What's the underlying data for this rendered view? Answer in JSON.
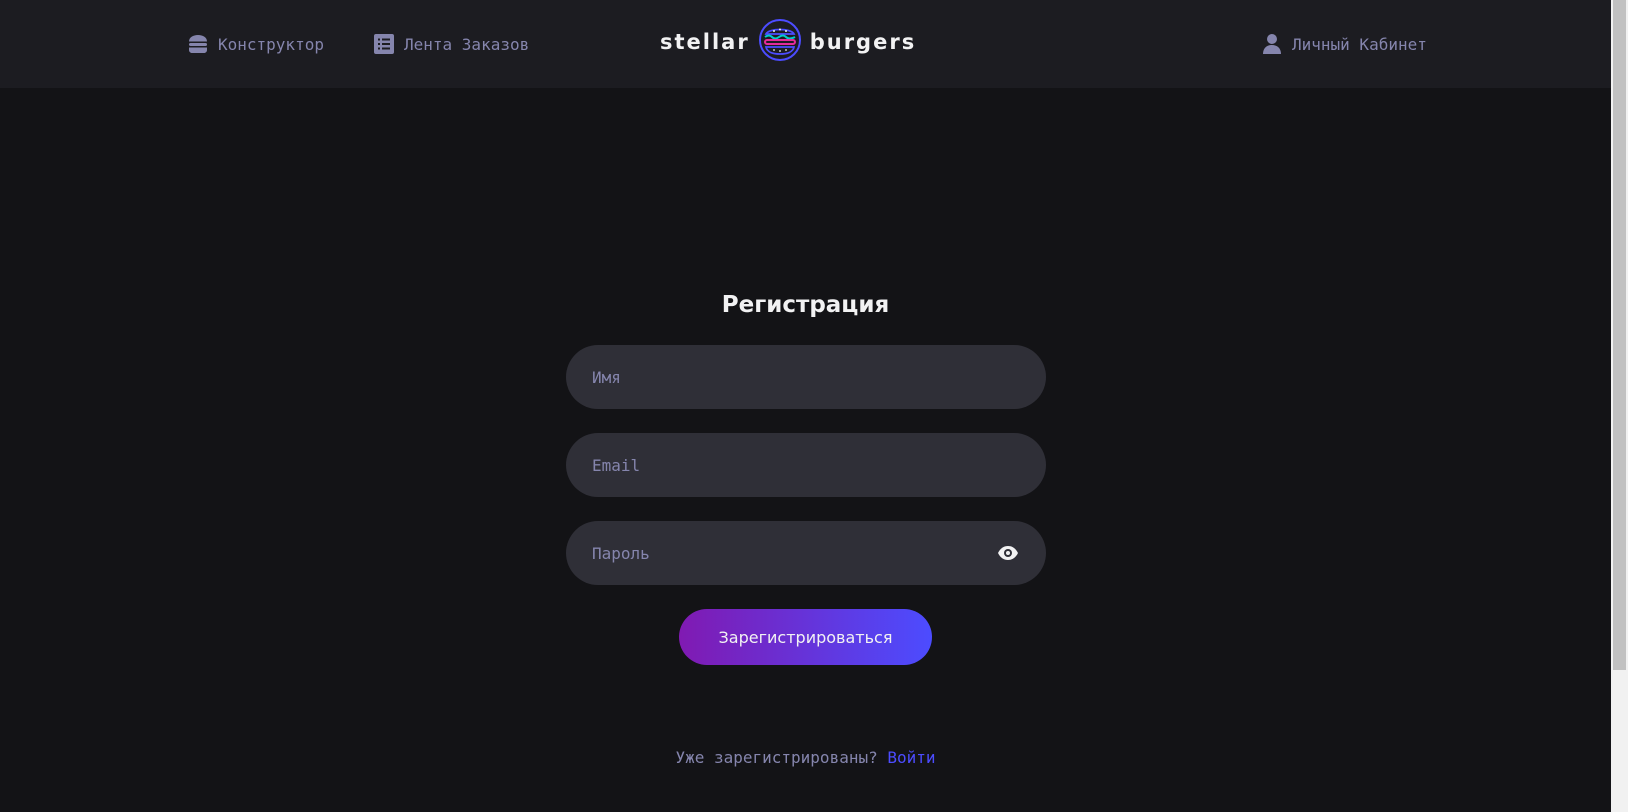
{
  "header": {
    "nav": {
      "constructor": {
        "label": "Конструктор",
        "icon": "burger-icon"
      },
      "feed": {
        "label": "Лента Заказов",
        "icon": "list-icon"
      },
      "profile": {
        "label": "Личный Кабинет",
        "icon": "profile-icon"
      }
    },
    "logo": {
      "left_word": "stellar",
      "right_word": "burgers"
    }
  },
  "form": {
    "title": "Регистрация",
    "name": {
      "placeholder": "Имя",
      "value": ""
    },
    "email": {
      "placeholder": "Email",
      "value": ""
    },
    "password": {
      "placeholder": "Пароль",
      "value": "",
      "icon": "eye-icon"
    },
    "submit_label": "Зарегистрироваться"
  },
  "footer": {
    "question": "Уже зарегистрированы?",
    "login_link": "Войти"
  },
  "colors": {
    "background": "#131316",
    "header": "#1c1c21",
    "input": "#2f2f37",
    "muted_text": "#8585ad",
    "accent": "#4c4cff",
    "gradient_start": "#801ab2"
  }
}
